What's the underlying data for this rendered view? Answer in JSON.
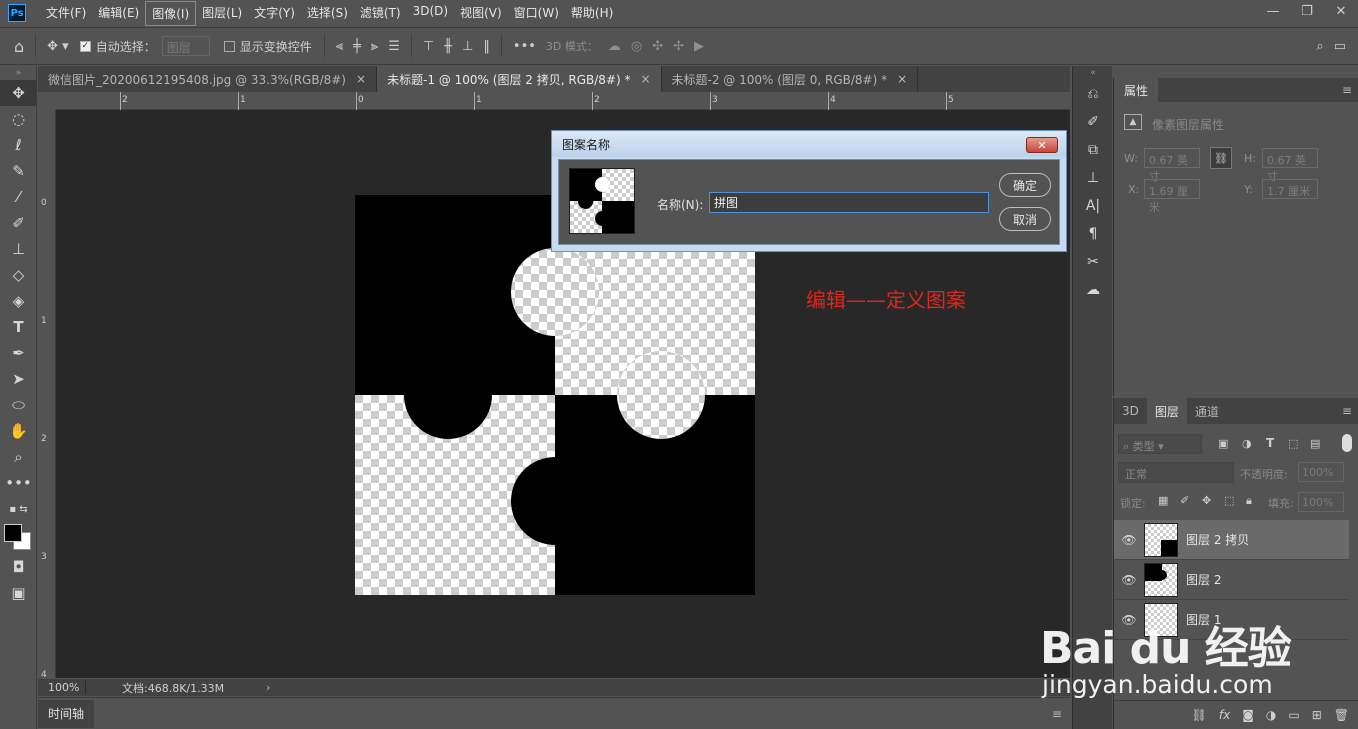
{
  "app": {
    "logo": "Ps",
    "menu": [
      "文件(F)",
      "编辑(E)",
      "图像(I)",
      "图层(L)",
      "文字(Y)",
      "选择(S)",
      "滤镜(T)",
      "3D(D)",
      "视图(V)",
      "窗口(W)",
      "帮助(H)"
    ],
    "active_menu_index": 2
  },
  "options": {
    "auto_select_label": "自动选择：",
    "auto_select_value": "图层",
    "show_transform_label": "显示变换控件",
    "mode_3d_label": "3D 模式："
  },
  "tabs": [
    {
      "label": "微信图片_20200612195408.jpg @ 33.3%(RGB/8#)",
      "active": false,
      "closable": true
    },
    {
      "label": "未标题-1 @ 100% (图层 2 拷贝, RGB/8#) *",
      "active": true,
      "closable": true
    },
    {
      "label": "未标题-2 @ 100% (图层 0, RGB/8#) *",
      "active": false,
      "closable": true
    }
  ],
  "ruler": {
    "h_labels": [
      "2",
      "1",
      "0",
      "1",
      "2",
      "3",
      "4",
      "5"
    ],
    "v_labels": [
      "0",
      "1",
      "2",
      "3",
      "4"
    ]
  },
  "annotation": "编辑——定义图案",
  "dialog": {
    "title": "图案名称",
    "name_label": "名称(N):",
    "name_value": "拼图",
    "ok_label": "确定",
    "cancel_label": "取消",
    "close_label": "✕"
  },
  "status": {
    "zoom": "100%",
    "doc_info": "文档:468.8K/1.33M",
    "timeline_tab": "时间轴"
  },
  "properties": {
    "tab": "属性",
    "subtitle": "像素图层属性",
    "w_label": "W:",
    "w_value": "0.67 英寸",
    "h_label": "H:",
    "h_value": "0.67 英寸",
    "x_label": "X:",
    "x_value": "1.69 厘米",
    "y_label": "Y:",
    "y_value": "1.7 厘米"
  },
  "layers_panel": {
    "tabs": [
      "3D",
      "图层",
      "通道"
    ],
    "active_tab_index": 1,
    "filter_label": "类型",
    "blend_mode": "正常",
    "opacity_label": "不透明度:",
    "opacity_value": "100%",
    "lock_label": "锁定:",
    "fill_label": "填充:",
    "fill_value": "100%",
    "layers": [
      {
        "name": "图层 2 拷贝",
        "visible": true,
        "active": true
      },
      {
        "name": "图层 2",
        "visible": true,
        "active": false
      },
      {
        "name": "图层 1",
        "visible": true,
        "active": false
      }
    ]
  },
  "watermark": {
    "main": "Bai du 经验",
    "sub": "jingyan.baidu.com"
  }
}
